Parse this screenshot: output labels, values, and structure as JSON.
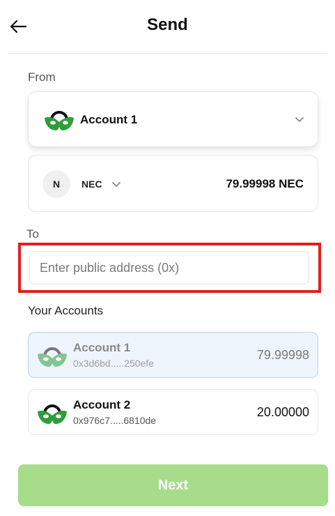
{
  "header": {
    "title": "Send",
    "back_icon": "arrow-left-icon"
  },
  "from": {
    "label": "From",
    "account_name": "Account 1",
    "token": {
      "symbol": "NEC",
      "icon_letter": "N",
      "balance": "79.99998 NEC"
    }
  },
  "to": {
    "label": "To",
    "placeholder": "Enter public address (0x)",
    "value": ""
  },
  "your_accounts": {
    "label": "Your Accounts",
    "items": [
      {
        "name": "Account 1",
        "address": "0x3d6bd.....250efe",
        "balance": "79.99998",
        "selected": true
      },
      {
        "name": "Account 2",
        "address": "0x976c7.....6810de",
        "balance": "20.00000",
        "selected": false
      }
    ]
  },
  "next_label": "Next",
  "colors": {
    "brand_green": "#2e9e3a",
    "next_button_bg": "#a7dc8b",
    "highlight_border": "#e02020"
  }
}
